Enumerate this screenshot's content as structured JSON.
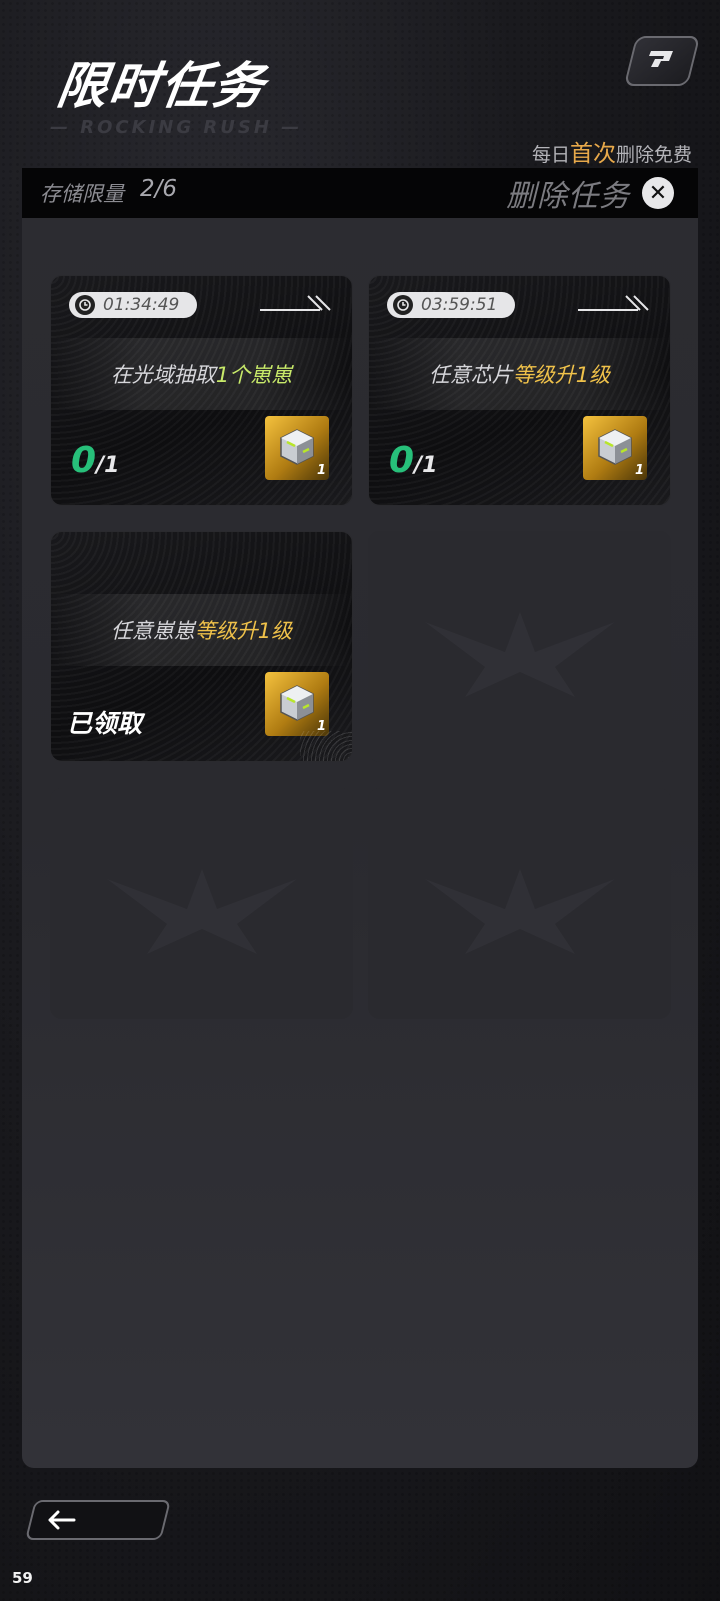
{
  "header": {
    "title": "限时任务",
    "subtitle_deco": "— ROCKING RUSH —",
    "free_note_prefix": "每日",
    "free_note_highlight": "首次",
    "free_note_suffix": "删除免费"
  },
  "storage": {
    "label": "存储限量",
    "value": "2/6"
  },
  "delete": {
    "label": "删除任务",
    "icon": "close-circle-icon"
  },
  "tasks": [
    {
      "timer": "01:34:49",
      "desc_prefix": "在光域抽取",
      "desc_accent": "1个崽崽",
      "progress_current": "0",
      "progress_total": "/1",
      "reward_icon": "chip-crate-icon",
      "reward_qty": "1",
      "status": "in_progress"
    },
    {
      "timer": "03:59:51",
      "desc_prefix": "任意芯片",
      "desc_accent": "等级升1级",
      "progress_current": "0",
      "progress_total": "/1",
      "reward_icon": "chip-crate-icon",
      "reward_qty": "1",
      "status": "in_progress"
    },
    {
      "desc_prefix": "任意崽崽",
      "desc_accent": "等级升1级",
      "claimed_label": "已领取",
      "reward_icon": "chip-crate-icon",
      "reward_qty": "1",
      "status": "claimed"
    }
  ],
  "empty_slots": 3,
  "footer": {
    "back_icon": "arrow-left-icon",
    "fps": "59"
  },
  "colors": {
    "progress_green": "#27c07a",
    "accent_green": "#c8ea6a",
    "accent_gold": "#f0c24a",
    "free_note_orange": "#e8a94a"
  }
}
